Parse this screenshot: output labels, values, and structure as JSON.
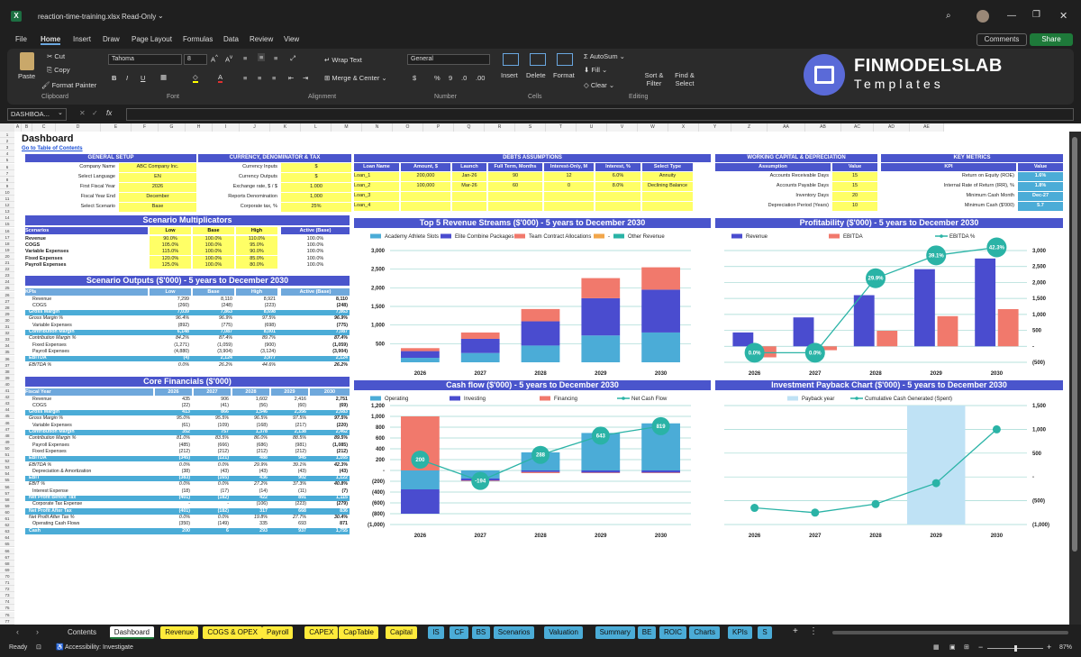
{
  "window": {
    "filename": "reaction-time-training.xlsx",
    "mode": "Read-Only"
  },
  "menu": [
    "File",
    "Home",
    "Insert",
    "Draw",
    "Page Layout",
    "Formulas",
    "Data",
    "Review",
    "View"
  ],
  "menu_right": {
    "comments": "Comments",
    "share": "Share"
  },
  "ribbon": {
    "paste": "Paste",
    "cut": "Cut",
    "copy": "Copy",
    "format_painter": "Format Painter",
    "clipboard": "Clipboard",
    "font_name": "Tahoma",
    "font_size": "8",
    "font": "Font",
    "wrap": "Wrap Text",
    "merge": "Merge & Center",
    "alignment": "Alignment",
    "numfmt": "General",
    "number": "Number",
    "insert": "Insert",
    "delete": "Delete",
    "format": "Format",
    "cells": "Cells",
    "autosum": "AutoSum",
    "fill": "Fill",
    "clear": "Clear",
    "sort": "Sort & Filter",
    "find": "Find & Select",
    "editing": "Editing",
    "logo1": "FINMODELSLAB",
    "logo2": "Templates"
  },
  "namebox": "DASHBOA...",
  "fx": "fx",
  "columns": [
    "A",
    "B",
    "C",
    "D",
    "E",
    "F",
    "G",
    "H",
    "I",
    "J",
    "K",
    "L",
    "M",
    "N",
    "O",
    "P",
    "Q",
    "R",
    "S",
    "T",
    "U",
    "V",
    "W",
    "X",
    "Y",
    "Z",
    "AA",
    "AB",
    "AC",
    "AD",
    "AE"
  ],
  "dashboard": {
    "title": "Dashboard",
    "toc": "Go to Table of Contents",
    "general_setup": {
      "title": "GENERAL SETUP",
      "rows": [
        [
          "Company Name",
          "ABC Company Inc."
        ],
        [
          "Select Language",
          "EN"
        ],
        [
          "First Fiscal Year",
          "2026"
        ],
        [
          "Fiscal Year End",
          "December"
        ],
        [
          "Select Scenario",
          "Base"
        ]
      ]
    },
    "currency": {
      "title": "CURRENCY, DENOMINATOR & TAX",
      "rows": [
        [
          "Currency Inputs",
          "$"
        ],
        [
          "Currency Outputs",
          "$"
        ],
        [
          "Exchange rate, $ / $",
          "1.000"
        ],
        [
          "Reports Denomination",
          "1,000"
        ],
        [
          "Corporate tax, %",
          "25%"
        ]
      ]
    },
    "debts": {
      "title": "DEBTS ASSUMPTIONS",
      "headers": [
        "Loan Name",
        "Amount, $",
        "Launch",
        "Full Term, Months",
        "Interest-Only, M",
        "Interest, %",
        "Select Type"
      ],
      "rows": [
        [
          "Loan_1",
          "200,000",
          "Jan-26",
          "90",
          "12",
          "6.0%",
          "Annuity"
        ],
        [
          "Loan_2",
          "100,000",
          "Mar-26",
          "60",
          "0",
          "8.0%",
          "Declining Balance"
        ],
        [
          "Loan_3",
          "",
          "",
          "",
          "",
          "",
          ""
        ],
        [
          "Loan_4",
          "",
          "",
          "",
          "",
          "",
          ""
        ]
      ]
    },
    "wc": {
      "title": "WORKING CAPITAL & DEPRECIATION",
      "headers": [
        "Assumption",
        "Value"
      ],
      "rows": [
        [
          "Accounts Receivable Days",
          "15"
        ],
        [
          "Accounts Payable Days",
          "15"
        ],
        [
          "Inventory Days",
          "20"
        ],
        [
          "Depreciation Period (Years)",
          "10"
        ]
      ]
    },
    "km": {
      "title": "KEY METRICS",
      "headers": [
        "KPI",
        "Value"
      ],
      "rows": [
        [
          "Return on Equity (ROE)",
          "1.6%"
        ],
        [
          "Internal Rate of Return (IRR), %",
          "1.8%"
        ],
        [
          "Minimum Cash Month",
          "Dec-27"
        ],
        [
          "Minimum Cash ($'000)",
          "5.7"
        ]
      ]
    },
    "scen_mult": {
      "title": "Scenario Multiplicators",
      "headers": [
        "Scenarios",
        "Low",
        "Base",
        "High",
        "Active (Base)"
      ],
      "rows": [
        [
          "Revenue",
          "90.0%",
          "100.0%",
          "110.0%",
          "100.0%"
        ],
        [
          "COGS",
          "105.0%",
          "100.0%",
          "95.0%",
          "100.0%"
        ],
        [
          "Variable Expenses",
          "115.0%",
          "100.0%",
          "90.0%",
          "100.0%"
        ],
        [
          "Fixed Expenses",
          "120.0%",
          "100.0%",
          "85.0%",
          "100.0%"
        ],
        [
          "Payroll Expenses",
          "125.0%",
          "100.0%",
          "80.0%",
          "100.0%"
        ]
      ]
    },
    "scen_out": {
      "title": "Scenario Outputs ($'000) - 5 years to December 2030",
      "headers": [
        "KPIs",
        "Low",
        "Base",
        "High",
        "Active (Base)"
      ],
      "rows": [
        [
          "Revenue",
          "7,299",
          "8,110",
          "8,921",
          "8,110",
          "n"
        ],
        [
          "COGS",
          "(260)",
          "(248)",
          "(223)",
          "(248)",
          "n"
        ],
        [
          "Gross Margin",
          "7,039",
          "7,863",
          "8,698",
          "7,863",
          "b"
        ],
        [
          "Gross Margin %",
          "96.4%",
          "96.9%",
          "97.5%",
          "96.9%",
          "i"
        ],
        [
          "Variable Expenses",
          "(892)",
          "(775)",
          "(698)",
          "(775)",
          "n"
        ],
        [
          "Contribution Margin",
          "6,148",
          "7,087",
          "8,001",
          "7,087",
          "b"
        ],
        [
          "Contribution Margin %",
          "84.2%",
          "87.4%",
          "89.7%",
          "87.4%",
          "i"
        ],
        [
          "Fixed Expenses",
          "(1,271)",
          "(1,059)",
          "(900)",
          "(1,059)",
          "n"
        ],
        [
          "Payroll Expenses",
          "(4,880)",
          "(3,904)",
          "(3,124)",
          "(3,904)",
          "n"
        ],
        [
          "EBITDA",
          "(4)",
          "2,124",
          "3,977",
          "2,124",
          "b"
        ],
        [
          "EBITDA %",
          "0.0%",
          "26.2%",
          "44.6%",
          "26.2%",
          "i"
        ]
      ]
    },
    "core": {
      "title": "Core Financials ($'000)",
      "headers": [
        "Fiscal Year",
        "2026",
        "2027",
        "2028",
        "2029",
        "2030"
      ],
      "rows": [
        [
          "Revenue",
          "435",
          "906",
          "1,602",
          "2,416",
          "2,751",
          "n"
        ],
        [
          "COGS",
          "(22)",
          "(41)",
          "(56)",
          "(60)",
          "(69)",
          "n"
        ],
        [
          "Gross Margin",
          "413",
          "866",
          "1,546",
          "2,356",
          "2,683",
          "b"
        ],
        [
          "Gross Margin %",
          "95.0%",
          "95.5%",
          "96.5%",
          "97.5%",
          "97.5%",
          "i"
        ],
        [
          "Variable Expenses",
          "(61)",
          "(109)",
          "(168)",
          "(217)",
          "(220)",
          "n"
        ],
        [
          "Contribution Margin",
          "352",
          "757",
          "1,378",
          "2,138",
          "2,462",
          "b"
        ],
        [
          "Contribution Margin %",
          "81.0%",
          "83.5%",
          "86.0%",
          "88.5%",
          "89.5%",
          "i"
        ],
        [
          "Payroll Expenses",
          "(485)",
          "(666)",
          "(686)",
          "(981)",
          "(1,085)",
          "n"
        ],
        [
          "Fixed Expenses",
          "(212)",
          "(212)",
          "(212)",
          "(212)",
          "(212)",
          "n"
        ],
        [
          "EBITDA",
          "(345)",
          "(121)",
          "488",
          "945",
          "1,165",
          "b"
        ],
        [
          "EBITDA %",
          "0.0%",
          "0.0%",
          "29.9%",
          "39.1%",
          "42.3%",
          "i"
        ],
        [
          "Depreciation & Amortization",
          "(38)",
          "(43)",
          "(43)",
          "(43)",
          "(43)",
          "n"
        ],
        [
          "EBIT",
          "(383)",
          "(165)",
          "436",
          "902",
          "1,122",
          "b"
        ],
        [
          "EBIT %",
          "0.0%",
          "0.0%",
          "27.2%",
          "37.3%",
          "40.8%",
          "i"
        ],
        [
          "Interest Expense",
          "(18)",
          "(17)",
          "(14)",
          "(11)",
          "(7)",
          "n"
        ],
        [
          "Net Profit Before Tax",
          "(401)",
          "(182)",
          "422",
          "891",
          "1,115",
          "b"
        ],
        [
          "Corporate Tax Expense",
          "-",
          "-",
          "(106)",
          "(223)",
          "(279)",
          "n"
        ],
        [
          "Net Profit After Tax",
          "(401)",
          "(182)",
          "317",
          "668",
          "836",
          "b"
        ],
        [
          "Net Profit After Tax %",
          "0.0%",
          "0.0%",
          "19.8%",
          "27.7%",
          "30.4%",
          "i"
        ],
        [
          "Operating Cash Flows",
          "(350)",
          "(149)",
          "335",
          "693",
          "871",
          "n"
        ],
        [
          "Cash",
          "200",
          "6",
          "293",
          "937",
          "1,755",
          "b"
        ]
      ]
    }
  },
  "chart_data": [
    {
      "type": "bar",
      "title": "Top 5 Revenue Streams ($'000) - 5 years to December 2030",
      "categories": [
        "2026",
        "2027",
        "2028",
        "2029",
        "2030"
      ],
      "ylim": [
        0,
        3000
      ],
      "yticks": [
        "500",
        "1,000",
        "1,500",
        "2,000",
        "2,500",
        "3,000"
      ],
      "series": [
        {
          "name": "Academy Athlete Slots",
          "color": "#4bacd7",
          "values": [
            120,
            250,
            450,
            720,
            800
          ]
        },
        {
          "name": "Elite Combine Packages",
          "color": "#4a4ccf",
          "values": [
            180,
            380,
            650,
            1000,
            1150
          ]
        },
        {
          "name": "Team Contract Allocations",
          "color": "#f1796c",
          "values": [
            80,
            170,
            330,
            540,
            600
          ]
        },
        {
          "name": "-",
          "color": "#f2a64a",
          "values": [
            0,
            0,
            0,
            0,
            0
          ]
        },
        {
          "name": "Other Revenue",
          "color": "#2ab3a6",
          "values": [
            0,
            0,
            0,
            0,
            0
          ]
        }
      ]
    },
    {
      "type": "bar",
      "title": "Profitability ($'000) - 5 years to December 2030",
      "categories": [
        "2026",
        "2027",
        "2028",
        "2029",
        "2030"
      ],
      "ylim": [
        -500,
        3000
      ],
      "yticks": [
        "(500)",
        "-",
        "500",
        "1,000",
        "1,500",
        "2,000",
        "2,500",
        "3,000"
      ],
      "series": [
        {
          "name": "Revenue",
          "color": "#4a4ccf",
          "values": [
            435,
            906,
            1602,
            2416,
            2751
          ]
        },
        {
          "name": "EBITDA",
          "color": "#f1796c",
          "values": [
            -345,
            -121,
            488,
            945,
            1165
          ]
        },
        {
          "name": "EBITDA %",
          "color": "#2ab3a6",
          "values": [
            0.0,
            0.0,
            29.9,
            39.1,
            42.3
          ],
          "labels": [
            "0.0%",
            "0.0%",
            "29.9%",
            "39.1%",
            "42.3%"
          ]
        }
      ]
    },
    {
      "type": "bar",
      "title": "Cash flow ($'000) - 5 years to December 2030",
      "categories": [
        "2026",
        "2027",
        "2028",
        "2029",
        "2030"
      ],
      "ylim": [
        -1000,
        1200
      ],
      "yticks": [
        "(1,000)",
        "(800)",
        "(600)",
        "(400)",
        "(200)",
        "-",
        "200",
        "400",
        "600",
        "800",
        "1,000",
        "1,200"
      ],
      "series": [
        {
          "name": "Operating",
          "color": "#4bacd7",
          "values": [
            -350,
            -149,
            335,
            693,
            871
          ]
        },
        {
          "name": "Investing",
          "color": "#4a4ccf",
          "values": [
            -450,
            -40,
            -30,
            -40,
            -40
          ]
        },
        {
          "name": "Financing",
          "color": "#f1796c",
          "values": [
            1000,
            -10,
            -20,
            -10,
            -10
          ]
        },
        {
          "name": "Net Cash Flow",
          "color": "#2ab3a6",
          "values": [
            200,
            -194,
            288,
            643,
            819
          ],
          "labels": [
            "200",
            "-194",
            "288",
            "643",
            "819"
          ]
        }
      ]
    },
    {
      "type": "line",
      "title": "Investment Payback Chart ($'000) - 5 years to December 2030",
      "categories": [
        "2026",
        "2027",
        "2028",
        "2029",
        "2030"
      ],
      "ylim": [
        -1000,
        1500
      ],
      "yticks": [
        "(1,000)",
        "(500)",
        "-",
        "500",
        "1,000",
        "1,500"
      ],
      "series": [
        {
          "name": "Payback year",
          "color": "#bfe2f5",
          "values": [
            0,
            0,
            0,
            1,
            0
          ]
        },
        {
          "name": "Cumulative Cash Generated (Spent)",
          "color": "#2ab3a6",
          "values": [
            -650,
            -750,
            -570,
            -130,
            1000
          ]
        }
      ]
    }
  ],
  "sheet_tabs": [
    {
      "label": "Contents",
      "bg": "#1f1f1f",
      "fg": "#ddd"
    },
    {
      "label": "Dashboard",
      "bg": "#ffffff",
      "fg": "#111"
    },
    {
      "label": "Revenue",
      "bg": "#ffeb3b",
      "fg": "#111"
    },
    {
      "label": "COGS & OPEX",
      "bg": "#ffeb3b",
      "fg": "#111"
    },
    {
      "label": "Payroll",
      "bg": "#ffeb3b",
      "fg": "#111"
    },
    {
      "label": "CAPEX",
      "bg": "#ffeb3b",
      "fg": "#111"
    },
    {
      "label": "CapTable",
      "bg": "#ffeb3b",
      "fg": "#111"
    },
    {
      "label": "Capital",
      "bg": "#ffeb3b",
      "fg": "#111"
    },
    {
      "label": "IS",
      "bg": "#4bacd7",
      "fg": "#111"
    },
    {
      "label": "CF",
      "bg": "#4bacd7",
      "fg": "#111"
    },
    {
      "label": "BS",
      "bg": "#4bacd7",
      "fg": "#111"
    },
    {
      "label": "Scenarios",
      "bg": "#4bacd7",
      "fg": "#111"
    },
    {
      "label": "Valuation",
      "bg": "#4bacd7",
      "fg": "#111"
    },
    {
      "label": "Summary",
      "bg": "#4bacd7",
      "fg": "#111"
    },
    {
      "label": "BE",
      "bg": "#4bacd7",
      "fg": "#111"
    },
    {
      "label": "ROIC",
      "bg": "#4bacd7",
      "fg": "#111"
    },
    {
      "label": "Charts",
      "bg": "#4bacd7",
      "fg": "#111"
    },
    {
      "label": "KPIs",
      "bg": "#4bacd7",
      "fg": "#111"
    },
    {
      "label": "S",
      "bg": "#4bacd7",
      "fg": "#111"
    }
  ],
  "status": {
    "ready": "Ready",
    "accessibility": "Accessibility: Investigate",
    "zoom": "87%"
  }
}
